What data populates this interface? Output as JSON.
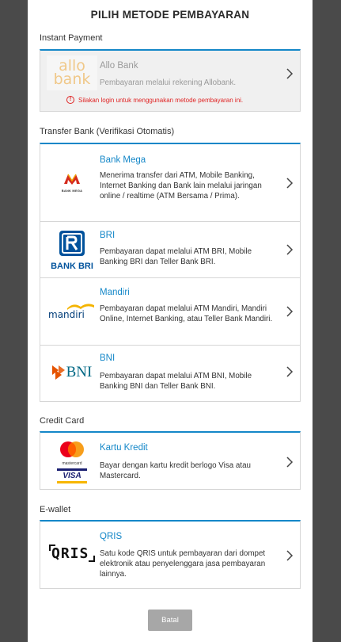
{
  "page": {
    "title": "PILIH METODE PEMBAYARAN"
  },
  "sections": {
    "instant": {
      "label": "Instant Payment"
    },
    "transfer": {
      "label": "Transfer Bank (Verifikasi Otomatis)"
    },
    "credit": {
      "label": "Credit Card"
    },
    "ewallet": {
      "label": "E-wallet"
    }
  },
  "allo": {
    "logo_top": "allo",
    "logo_bottom": "bank",
    "name": "Allo Bank",
    "desc": "Pembayaran melalui rekening Allobank.",
    "warning": "Silakan login untuk menggunakan metode pembayaran ini.",
    "warning_icon": "!"
  },
  "banks": {
    "mega": {
      "name": "Bank Mega",
      "desc": "Menerima transfer dari ATM, Mobile Banking, Internet Banking dan Bank lain melalui jaringan online / realtime (ATM Bersama / Prima).",
      "logo_text": "BANK MEGA"
    },
    "bri": {
      "name": "BRI",
      "desc": "Pembayaran dapat melalui ATM BRI, Mobile Banking BRI dan Teller Bank BRI.",
      "logo_text": "BANK BRI"
    },
    "mandiri": {
      "name": "Mandiri",
      "desc": "Pembayaran dapat melalui ATM Mandiri, Mandiri Online, Internet Banking, atau Teller Bank Mandiri.",
      "logo_text": "mandiri"
    },
    "bni": {
      "name": "BNI",
      "desc": "Pembayaran dapat melalui ATM BNI, Mobile Banking BNI dan Teller Bank BNI.",
      "logo_text": "BNI"
    }
  },
  "credit_card": {
    "name": "Kartu Kredit",
    "desc": "Bayar dengan kartu kredit berlogo Visa atau Mastercard.",
    "mc_text": "mastercard",
    "visa_text": "VISA"
  },
  "qris": {
    "name": "QRIS",
    "desc": "Satu kode QRIS untuk pembayaran dari dompet elektronik atau penyelenggara jasa pembayaran lainnya.",
    "logo_text": "QRIS"
  },
  "footer": {
    "cancel_label": "Batal"
  },
  "colors": {
    "accent": "#1487c8",
    "warning": "#e02424",
    "overlay": "#4a4a4a",
    "mega_red": "#d52b1e",
    "bri_blue": "#00529c",
    "mandiri_yellow": "#f4b400",
    "bni_orange": "#e55300",
    "bni_teal": "#006885"
  }
}
